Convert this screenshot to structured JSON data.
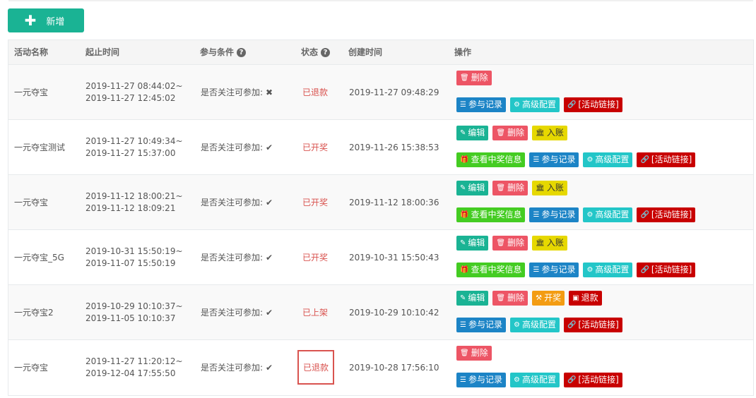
{
  "toolbar": {
    "add_label": "新增",
    "add_icon": "plus-icon"
  },
  "table": {
    "headers": {
      "name": "活动名称",
      "period": "起止时间",
      "condition": "参与条件",
      "status": "状态",
      "created": "创建时间",
      "actions": "操作"
    },
    "help_icon": "question-circle-icon",
    "rows": [
      {
        "name": "一元夺宝",
        "start": "2019-11-27 08:44:02~",
        "end": "2019-11-27 12:45:02",
        "condition": "是否关注可参加:",
        "condition_mark": "✖",
        "status": "已退款",
        "created": "2019-11-27 09:48:29",
        "row1": [
          {
            "label": "删除",
            "icon": "trash-icon",
            "type": "del"
          }
        ],
        "row2": [
          {
            "label": "参与记录",
            "icon": "table-icon",
            "type": "blue"
          },
          {
            "label": "高级配置",
            "icon": "gears-icon",
            "type": "cyan"
          },
          {
            "label": "[活动链接]",
            "icon": "link-icon",
            "type": "link"
          }
        ]
      },
      {
        "name": "一元夺宝测试",
        "start": "2019-11-27 10:49:34~",
        "end": "2019-11-27 15:37:00",
        "condition": "是否关注可参加:",
        "condition_mark": "✔",
        "status": "已开奖",
        "created": "2019-11-26 15:38:53",
        "row1": [
          {
            "label": "编辑",
            "icon": "edit-icon",
            "type": "edit"
          },
          {
            "label": "删除",
            "icon": "trash-icon",
            "type": "del"
          },
          {
            "label": "入账",
            "icon": "bank-icon",
            "type": "in"
          }
        ],
        "row2": [
          {
            "label": "查看中奖信息",
            "icon": "gift-icon",
            "type": "green"
          },
          {
            "label": "参与记录",
            "icon": "table-icon",
            "type": "blue"
          },
          {
            "label": "高级配置",
            "icon": "gears-icon",
            "type": "cyan"
          },
          {
            "label": "[活动链接]",
            "icon": "link-icon",
            "type": "link"
          }
        ]
      },
      {
        "name": "一元夺宝",
        "start": "2019-11-12 18:00:21~",
        "end": "2019-11-12 18:09:21",
        "condition": "是否关注可参加:",
        "condition_mark": "✔",
        "status": "已开奖",
        "created": "2019-11-12 18:00:36",
        "row1": [
          {
            "label": "编辑",
            "icon": "edit-icon",
            "type": "edit"
          },
          {
            "label": "删除",
            "icon": "trash-icon",
            "type": "del"
          },
          {
            "label": "入账",
            "icon": "bank-icon",
            "type": "in"
          }
        ],
        "row2": [
          {
            "label": "查看中奖信息",
            "icon": "gift-icon",
            "type": "green"
          },
          {
            "label": "参与记录",
            "icon": "table-icon",
            "type": "blue"
          },
          {
            "label": "高级配置",
            "icon": "gears-icon",
            "type": "cyan"
          },
          {
            "label": "[活动链接]",
            "icon": "link-icon",
            "type": "link"
          }
        ]
      },
      {
        "name": "一元夺宝_5G",
        "start": "2019-10-31 15:50:19~",
        "end": "2019-11-07 15:50:19",
        "condition": "是否关注可参加:",
        "condition_mark": "✔",
        "status": "已开奖",
        "created": "2019-10-31 15:50:43",
        "row1": [
          {
            "label": "编辑",
            "icon": "edit-icon",
            "type": "edit"
          },
          {
            "label": "删除",
            "icon": "trash-icon",
            "type": "del"
          },
          {
            "label": "入账",
            "icon": "bank-icon",
            "type": "in"
          }
        ],
        "row2": [
          {
            "label": "查看中奖信息",
            "icon": "gift-icon",
            "type": "green"
          },
          {
            "label": "参与记录",
            "icon": "table-icon",
            "type": "blue"
          },
          {
            "label": "高级配置",
            "icon": "gears-icon",
            "type": "cyan"
          },
          {
            "label": "[活动链接]",
            "icon": "link-icon",
            "type": "link"
          }
        ]
      },
      {
        "name": "一元夺宝2",
        "start": "2019-10-29 10:10:37~",
        "end": "2019-11-05 10:10:37",
        "condition": "是否关注可参加:",
        "condition_mark": "✔",
        "status": "已上架",
        "created": "2019-10-29 10:10:42",
        "row1": [
          {
            "label": "编辑",
            "icon": "edit-icon",
            "type": "edit"
          },
          {
            "label": "删除",
            "icon": "trash-icon",
            "type": "del"
          },
          {
            "label": "开奖",
            "icon": "gavel-icon",
            "type": "orange"
          },
          {
            "label": "退款",
            "icon": "money-icon",
            "type": "red"
          }
        ],
        "row2": [
          {
            "label": "参与记录",
            "icon": "table-icon",
            "type": "blue"
          },
          {
            "label": "高级配置",
            "icon": "gears-icon",
            "type": "cyan"
          },
          {
            "label": "[活动链接]",
            "icon": "link-icon",
            "type": "link"
          }
        ]
      },
      {
        "name": "一元夺宝",
        "start": "2019-11-27 11:20:12~",
        "end": "2019-12-04 17:55:50",
        "condition": "是否关注可参加:",
        "condition_mark": "✔",
        "status": "已退款",
        "status_highlight": true,
        "created": "2019-10-28 17:56:10",
        "row1": [
          {
            "label": "删除",
            "icon": "trash-icon",
            "type": "del"
          }
        ],
        "row2": [
          {
            "label": "参与记录",
            "icon": "table-icon",
            "type": "blue"
          },
          {
            "label": "高级配置",
            "icon": "gears-icon",
            "type": "cyan"
          },
          {
            "label": "[活动链接]",
            "icon": "link-icon",
            "type": "link"
          }
        ]
      }
    ]
  },
  "colors": {
    "primary": "#1ab394",
    "danger": "#ed5565",
    "status_text": "#d9534f",
    "highlight_border": "#d9534f"
  }
}
